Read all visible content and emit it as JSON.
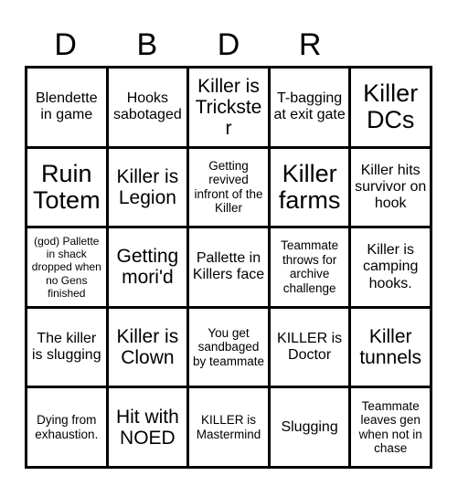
{
  "card": {
    "title_letters": [
      "D",
      "B",
      "D",
      "R",
      ""
    ],
    "rows": [
      [
        {
          "text": "Blendette in game",
          "size": "fs-m"
        },
        {
          "text": "Hooks sabotaged",
          "size": "fs-m"
        },
        {
          "text": "Killer is Trickster",
          "size": "fs-l"
        },
        {
          "text": "T-bagging at exit gate",
          "size": "fs-m"
        },
        {
          "text": "Killer DCs",
          "size": "fs-xl"
        }
      ],
      [
        {
          "text": "Ruin Totem",
          "size": "fs-xl"
        },
        {
          "text": "Killer is Legion",
          "size": "fs-l"
        },
        {
          "text": "Getting revived infront of the Killer",
          "size": "fs-s"
        },
        {
          "text": "Killer farms",
          "size": "fs-xl"
        },
        {
          "text": "Killer hits survivor on hook",
          "size": "fs-m"
        }
      ],
      [
        {
          "text": "(god) Pallette in shack dropped when no Gens finished",
          "size": "fs-xs"
        },
        {
          "text": "Getting mori'd",
          "size": "fs-l"
        },
        {
          "text": "Pallette in Killers face",
          "size": "fs-m"
        },
        {
          "text": "Teammate throws for archive challenge",
          "size": "fs-s"
        },
        {
          "text": "Killer is camping hooks.",
          "size": "fs-m"
        }
      ],
      [
        {
          "text": "The killer is slugging",
          "size": "fs-m"
        },
        {
          "text": "Killer is Clown",
          "size": "fs-l"
        },
        {
          "text": "You get sandbaged by teammate",
          "size": "fs-s"
        },
        {
          "text": "KILLER is Doctor",
          "size": "fs-m"
        },
        {
          "text": "Killer tunnels",
          "size": "fs-l"
        }
      ],
      [
        {
          "text": "Dying from exhaustion.",
          "size": "fs-s"
        },
        {
          "text": "Hit with NOED",
          "size": "fs-l"
        },
        {
          "text": "KILLER is Mastermind",
          "size": "fs-s"
        },
        {
          "text": "Slugging",
          "size": "fs-m"
        },
        {
          "text": "Teammate leaves gen when not in chase",
          "size": "fs-s"
        }
      ]
    ]
  },
  "colors": {
    "background": "#ffffff",
    "ink": "#000000",
    "grid_line": "#000000"
  }
}
